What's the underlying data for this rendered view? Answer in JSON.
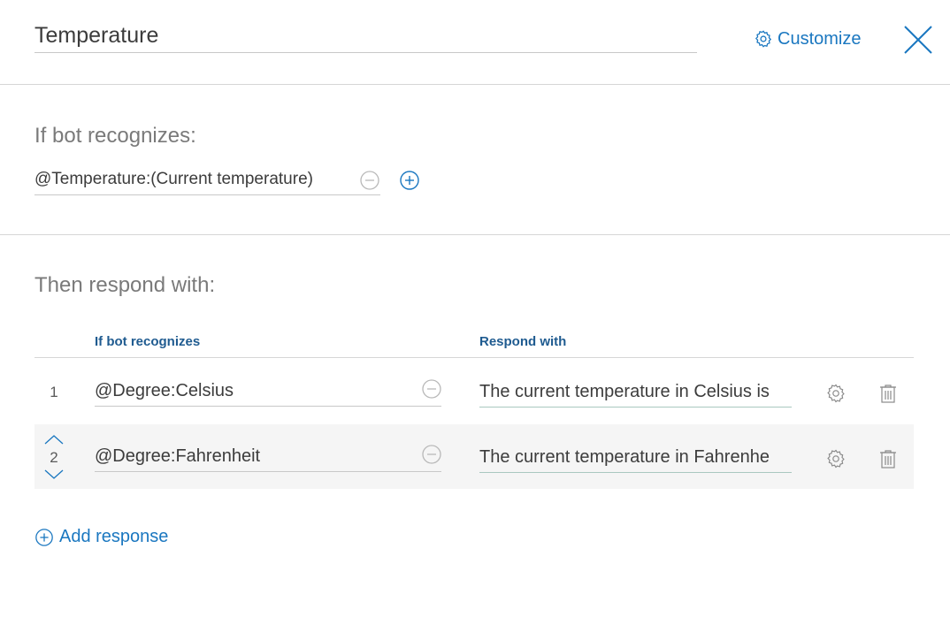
{
  "header": {
    "title_value": "Temperature",
    "customize_label": "Customize",
    "accent_color": "#1a77c0"
  },
  "condition_section": {
    "heading": "If bot recognizes:",
    "condition_value": "@Temperature:(Current temperature)",
    "icons": [
      "minus-circle-icon",
      "plus-circle-icon"
    ]
  },
  "response_section": {
    "heading": "Then respond with:",
    "columns": {
      "if_header": "If bot recognizes",
      "respond_header": "Respond with"
    },
    "rows": [
      {
        "number": "1",
        "condition": "@Degree:Celsius",
        "response": "The current temperature in Celsius is"
      },
      {
        "number": "2",
        "condition": "@Degree:Fahrenheit",
        "response": "The current temperature in Fahrenhe"
      }
    ],
    "add_label": "Add response"
  }
}
